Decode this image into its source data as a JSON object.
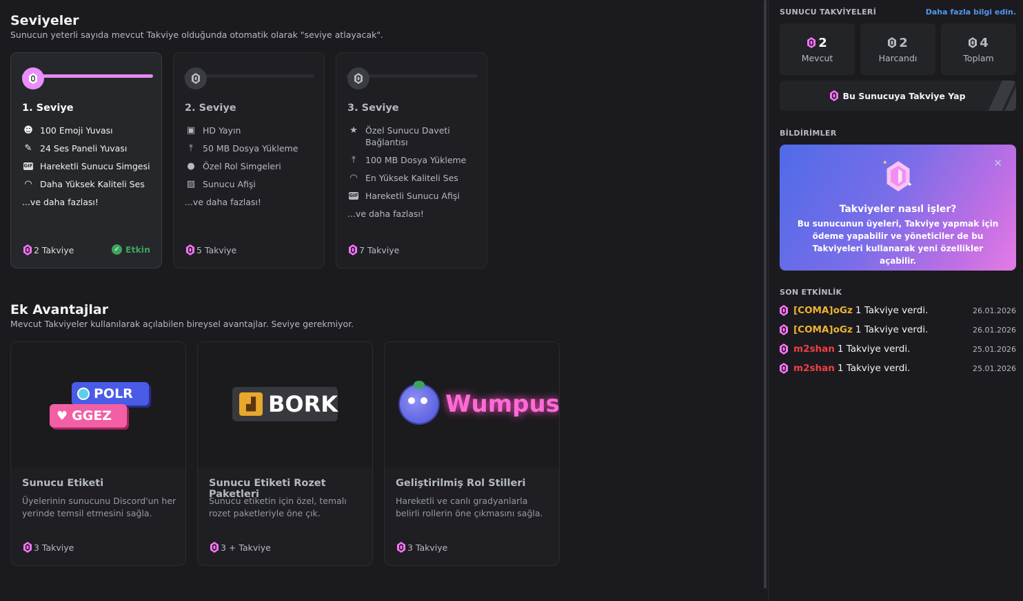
{
  "levels": {
    "title": "Seviyeler",
    "subtitle": "Sunucun yeterli sayıda mevcut Takviye olduğunda otomatik olarak \"seviye atlayacak\".",
    "progress_fraction": 1.0,
    "tiers": [
      {
        "name": "1. Seviye",
        "perks": [
          "100 Emoji Yuvası",
          "24 Ses Paneli Yuvası",
          "Hareketli Sunucu Simgesi",
          "Daha Yüksek Kaliteli Ses"
        ],
        "icons": [
          "emoji-icon",
          "soundboard-icon",
          "gif-icon",
          "headphones-icon"
        ],
        "more": "...ve daha fazlası!",
        "cost": "2 Takviye",
        "status": "Etkin"
      },
      {
        "name": "2. Seviye",
        "perks": [
          "HD Yayın",
          "50 MB Dosya Yükleme",
          "Özel Rol Simgeleri",
          "Sunucu Afişi"
        ],
        "icons": [
          "screen-share-icon",
          "upload-icon",
          "role-icon",
          "banner-icon"
        ],
        "more": "...ve daha fazlası!",
        "cost": "5 Takviye"
      },
      {
        "name": "3. Seviye",
        "perks": [
          "Özel Sunucu Daveti Bağlantısı",
          "100 MB Dosya Yükleme",
          "En Yüksek Kaliteli Ses",
          "Hareketli Sunucu Afişi"
        ],
        "icons": [
          "star-icon",
          "upload-icon",
          "headphones-icon",
          "gif-icon"
        ],
        "more": "...ve daha fazlası!",
        "cost": "7 Takviye"
      }
    ]
  },
  "extra": {
    "title": "Ek Avantajlar",
    "subtitle": "Mevcut Takviyeler kullanılarak açılabilen bireysel avantajlar. Seviye gerekmiyor.",
    "perks": [
      {
        "title": "Sunucu Etiketi",
        "desc": "Üyelerinin sunucunu Discord'un her yerinde temsil etmesini sağla.",
        "cost": "3 Takviye",
        "art": {
          "tag1": "POLR",
          "tag2": "GGEZ"
        }
      },
      {
        "title": "Sunucu Etiketi Rozet Paketleri",
        "desc": "Sunucu etiketin için özel, temalı rozet paketleriyle öne çık.",
        "cost": "3 + Takviye",
        "art": {
          "tag": "BORK"
        }
      },
      {
        "title": "Geliştirilmiş Rol Stilleri",
        "desc": "Hareketli ve canlı gradyanlarla belirli rollerin öne çıkmasını sağla.",
        "cost": "3 Takviye",
        "art": {
          "name": "Wumpus"
        }
      }
    ]
  },
  "sidebar": {
    "boosts_title": "SUNUCU TAKVİYELERİ",
    "learn_more": "Daha fazla bilgi edin.",
    "stats": [
      {
        "value": "2",
        "label": "Mevcut"
      },
      {
        "value": "2",
        "label": "Harcandı"
      },
      {
        "value": "4",
        "label": "Toplam"
      }
    ],
    "boost_button": "Bu Sunucuya Takviye Yap",
    "notifications_title": "BİLDİRİMLER",
    "notification": {
      "title": "Takviyeler nasıl işler?",
      "body": "Bu sunucunun üyeleri, Takviye yapmak için ödeme yapabilir ve yöneticiler de bu Takviyeleri kullanarak yeni özellikler açabilir."
    },
    "activity_title": "SON ETKİNLİK",
    "activity": [
      {
        "user": "[COMA]oGz",
        "action": "1 Takviye verdi.",
        "date": "26.01.2026",
        "color": "#f0b232"
      },
      {
        "user": "[COMA]oGz",
        "action": "1 Takviye verdi.",
        "date": "26.01.2026",
        "color": "#f0b232"
      },
      {
        "user": "m2shan",
        "action": "1 Takviye verdi.",
        "date": "25.01.2026",
        "color": "#f23f43"
      },
      {
        "user": "m2shan",
        "action": "1 Takviye verdi.",
        "date": "25.01.2026",
        "color": "#f23f43"
      }
    ]
  },
  "colors": {
    "boost_pink": "#ff73fa",
    "active_green": "#3ba55d",
    "link_blue": "#5197ed"
  }
}
